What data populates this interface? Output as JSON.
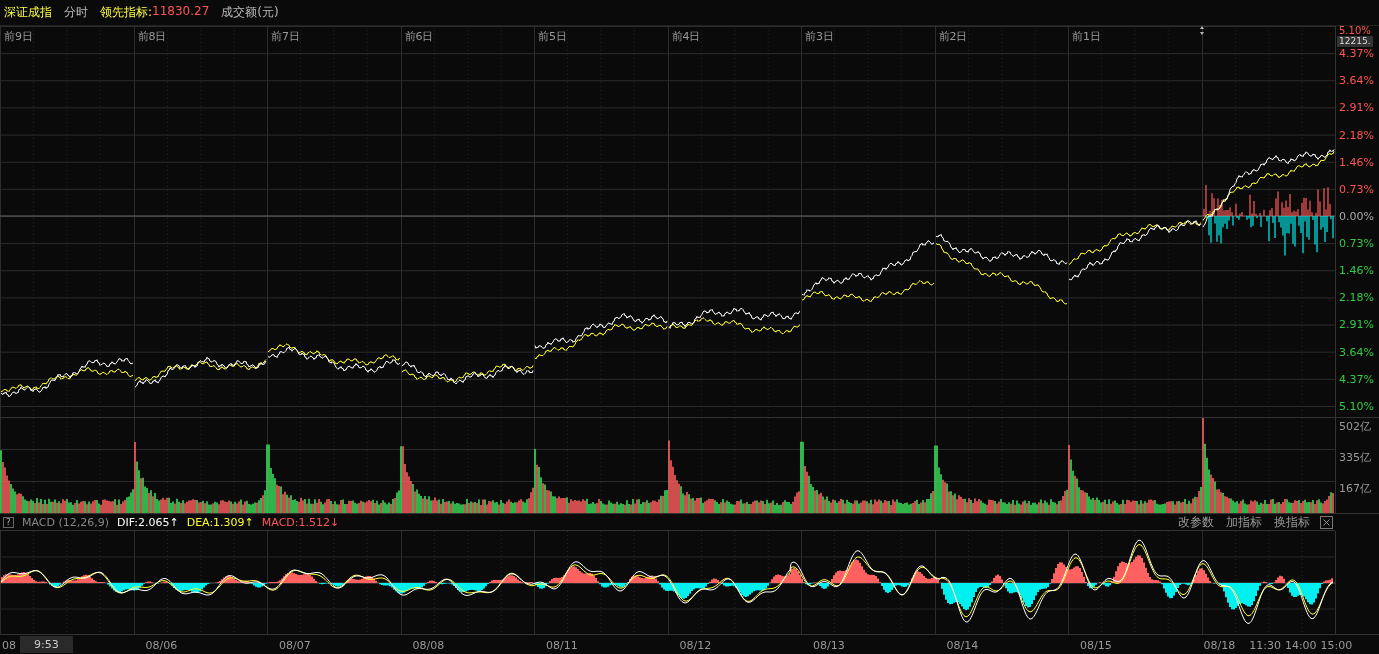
{
  "header": {
    "index_name": "深证成指",
    "mode": "分时",
    "leading_label": "领先指标:",
    "leading_value": "11830.27",
    "volume_label": "成交额(元)"
  },
  "day_labels": [
    "前9日",
    "前8日",
    "前7日",
    "前6日",
    "前5日",
    "前4日",
    "前3日",
    "前2日",
    "前1日"
  ],
  "price_tag": "12215.",
  "price_axis": [
    {
      "text": "5.10%",
      "color": "#ff5555"
    },
    {
      "text": "4.37%",
      "color": "#ff5555"
    },
    {
      "text": "3.64%",
      "color": "#ff5555"
    },
    {
      "text": "2.91%",
      "color": "#ff5555"
    },
    {
      "text": "2.18%",
      "color": "#ff5555"
    },
    {
      "text": "1.46%",
      "color": "#ff5555"
    },
    {
      "text": "0.73%",
      "color": "#ff5555"
    },
    {
      "text": "0.00%",
      "color": "#aaaaaa"
    },
    {
      "text": "0.73%",
      "color": "#33cc44"
    },
    {
      "text": "1.46%",
      "color": "#33cc44"
    },
    {
      "text": "2.18%",
      "color": "#33cc44"
    },
    {
      "text": "2.91%",
      "color": "#33cc44"
    },
    {
      "text": "3.64%",
      "color": "#33cc44"
    },
    {
      "text": "4.37%",
      "color": "#33cc44"
    },
    {
      "text": "5.10%",
      "color": "#33cc44"
    }
  ],
  "volume_axis": [
    "502亿",
    "335亿",
    "167亿"
  ],
  "macd": {
    "help": "?",
    "name": "MACD (12,26,9)",
    "dif": "DIF:2.065↑",
    "dea": "DEA:1.309↑",
    "macd_value": "MACD:1.512↓",
    "buttons": [
      "改参数",
      "加指标",
      "换指标"
    ]
  },
  "date_axis": {
    "cursor_time": "9:53",
    "days": [
      [
        "08"
      ],
      [
        "08/06"
      ],
      [
        "08/07"
      ],
      [
        "08/08"
      ],
      [
        "08/11"
      ],
      [
        "08/12"
      ],
      [
        "08/13"
      ],
      [
        "08/14"
      ],
      [
        "08/15"
      ],
      [
        "08/18",
        "11:30",
        "14:00",
        "15:00"
      ]
    ]
  }
}
